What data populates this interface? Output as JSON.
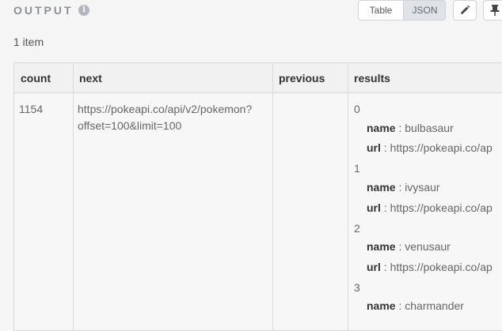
{
  "output": {
    "title": "OUTPUT",
    "info_icon": "info-icon",
    "tabs": {
      "table": "Table",
      "json": "JSON"
    },
    "edit_icon": "pencil-icon",
    "pin_icon": "pin-icon"
  },
  "summary": "1 item",
  "table": {
    "headers": [
      "count",
      "next",
      "previous",
      "results"
    ],
    "row": {
      "count": "1154",
      "next_line1": "https://pokeapi.co/api/v2/pokemon?",
      "next_line2": "offset=100&limit=100",
      "previous": ""
    },
    "results": [
      {
        "index": "0",
        "name": "bulbasaur",
        "url": "https://pokeapi.co/ap"
      },
      {
        "index": "1",
        "name": "ivysaur",
        "url": "https://pokeapi.co/ap"
      },
      {
        "index": "2",
        "name": "venusaur",
        "url": "https://pokeapi.co/ap"
      },
      {
        "index": "3",
        "name": "charmander"
      }
    ],
    "labels": {
      "name": "name",
      "url": "url",
      "sep": " : "
    }
  }
}
